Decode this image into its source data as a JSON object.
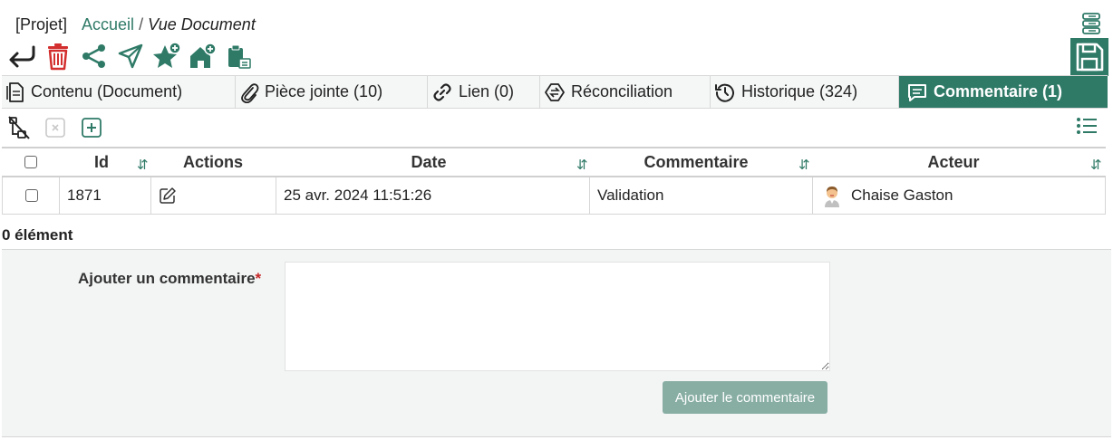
{
  "breadcrumb": {
    "project": "[Projet]",
    "home": "Accueil",
    "separator": "/",
    "current": "Vue Document"
  },
  "toolbar": {
    "buttons": [
      "back",
      "delete",
      "share",
      "send",
      "add-favorite",
      "add-home",
      "clipboard-paste"
    ],
    "accent_color": "#2f7a67",
    "danger_color": "#d32f2f"
  },
  "tabs": [
    {
      "label": "Contenu (Document)",
      "icon": "document-icon",
      "active": false
    },
    {
      "label": "Pièce jointe (10)",
      "icon": "paperclip-icon",
      "active": false
    },
    {
      "label": "Lien (0)",
      "icon": "link-icon",
      "active": false
    },
    {
      "label": "Réconciliation",
      "icon": "reconciliation-icon",
      "active": false
    },
    {
      "label": "Historique (324)",
      "icon": "history-icon",
      "active": false
    },
    {
      "label": "Commentaire (1)",
      "icon": "comment-icon",
      "active": true
    }
  ],
  "grid": {
    "columns": {
      "id": "Id",
      "actions": "Actions",
      "date": "Date",
      "commentaire": "Commentaire",
      "acteur": "Acteur"
    },
    "rows": [
      {
        "id": "1871",
        "date": "25 avr. 2024 11:51:26",
        "commentaire": "Validation",
        "acteur": "Chaise Gaston"
      }
    ],
    "count_label": "0 élément"
  },
  "form": {
    "label": "Ajouter un commentaire",
    "required_mark": "*",
    "textarea_value": "",
    "submit_label": "Ajouter le commentaire"
  }
}
